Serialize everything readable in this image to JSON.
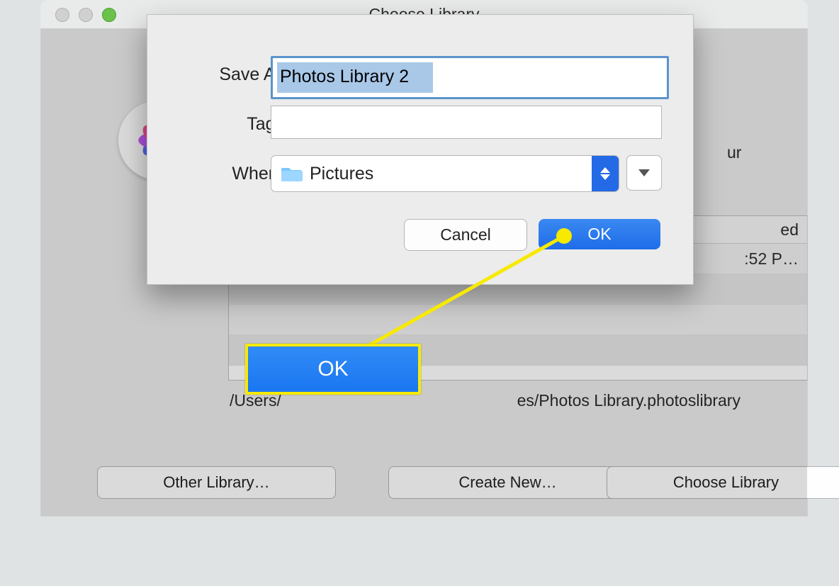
{
  "window": {
    "title": "Choose Library",
    "description_suffix": "ur",
    "path_prefix": "/Users/",
    "path_suffix": "es/Photos Library.photoslibrary"
  },
  "table": {
    "header_modified": "ed",
    "row_time": ":52 P…"
  },
  "bottom_buttons": {
    "other": "Other Library…",
    "create": "Create New…",
    "choose": "Choose Library"
  },
  "sheet": {
    "saveas_label": "Save As:",
    "saveas_value": "Photos Library 2",
    "tags_label": "Tags:",
    "tags_value": "",
    "where_label": "Where:",
    "where_value": "Pictures",
    "cancel": "Cancel",
    "ok": "OK"
  },
  "callout": {
    "label": "OK"
  }
}
